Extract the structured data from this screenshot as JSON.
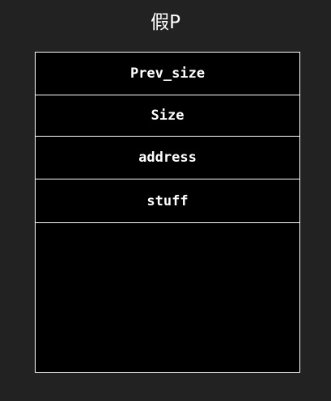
{
  "title": "假P",
  "chunk": {
    "fields": [
      "Prev_size",
      "Size",
      "address",
      "stuff"
    ]
  },
  "colors": {
    "background": "#222222",
    "box_fill": "#000000",
    "line_and_text": "#ffffff"
  }
}
